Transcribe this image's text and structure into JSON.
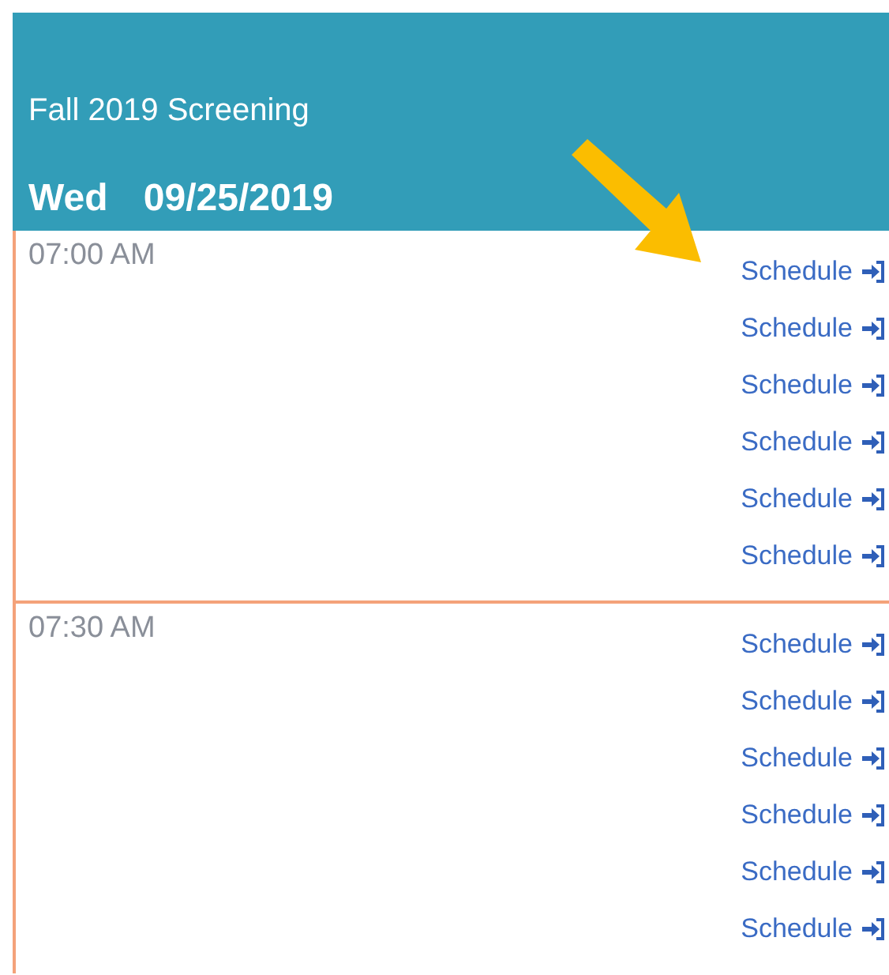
{
  "header": {
    "title": "Fall 2019 Screening",
    "day": "Wed",
    "date": "09/25/2019"
  },
  "slots": [
    {
      "time": "07:00 AM",
      "links": [
        "Schedule",
        "Schedule",
        "Schedule",
        "Schedule",
        "Schedule",
        "Schedule"
      ]
    },
    {
      "time": "07:30 AM",
      "links": [
        "Schedule",
        "Schedule",
        "Schedule",
        "Schedule",
        "Schedule",
        "Schedule"
      ]
    }
  ]
}
